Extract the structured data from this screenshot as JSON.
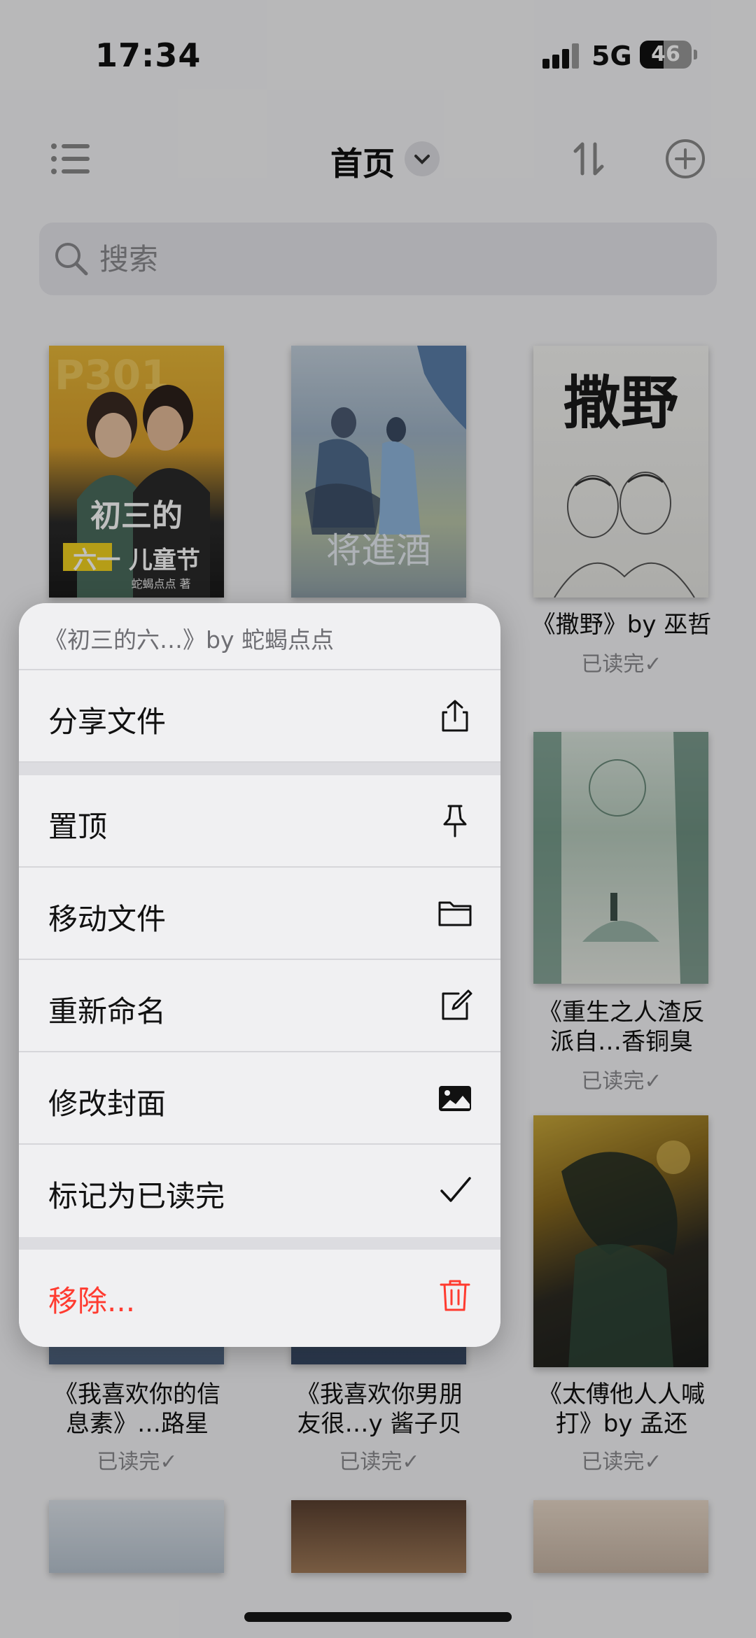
{
  "status_bar": {
    "time": "17:34",
    "network": "5G",
    "battery": "46"
  },
  "nav": {
    "title": "首页"
  },
  "search": {
    "placeholder": "搜索"
  },
  "books": [
    {
      "title": "",
      "status": ""
    },
    {
      "title": "",
      "status": ""
    },
    {
      "title": "《撒野》by 巫哲",
      "status": "已读完✓"
    },
    {
      "title": "",
      "status": ""
    },
    {
      "title": "",
      "status": ""
    },
    {
      "title_line1": "《重生之人渣反",
      "title_line2": "派自…香铜臭",
      "status": "已读完✓"
    },
    {
      "title_line1": "《我喜欢你的信",
      "title_line2": "息素》…路星",
      "status": "已读完✓"
    },
    {
      "title_line1": "《我喜欢你男朋",
      "title_line2": "友很…y 酱子贝",
      "status": "已读完✓"
    },
    {
      "title_line1": "《太傅他人人喊",
      "title_line2": "打》by 孟还",
      "status": "已读完✓"
    }
  ],
  "cover_text": {
    "book1_title": "初三的",
    "book1_title2": "六一 儿童节",
    "book1_author": "蛇蝎点点 著",
    "book1_badge": "P301",
    "book2_title": "将進酒",
    "book3_title": "撒野"
  },
  "context_menu": {
    "header": "《初三的六…》by 蛇蝎点点",
    "items": {
      "share": "分享文件",
      "pin": "置顶",
      "move": "移动文件",
      "rename": "重新命名",
      "edit_cover": "修改封面",
      "mark_read": "标记为已读完",
      "remove": "移除..."
    }
  },
  "colors": {
    "danger": "#ff3b30",
    "menu_bg": "#f0f0f2"
  }
}
